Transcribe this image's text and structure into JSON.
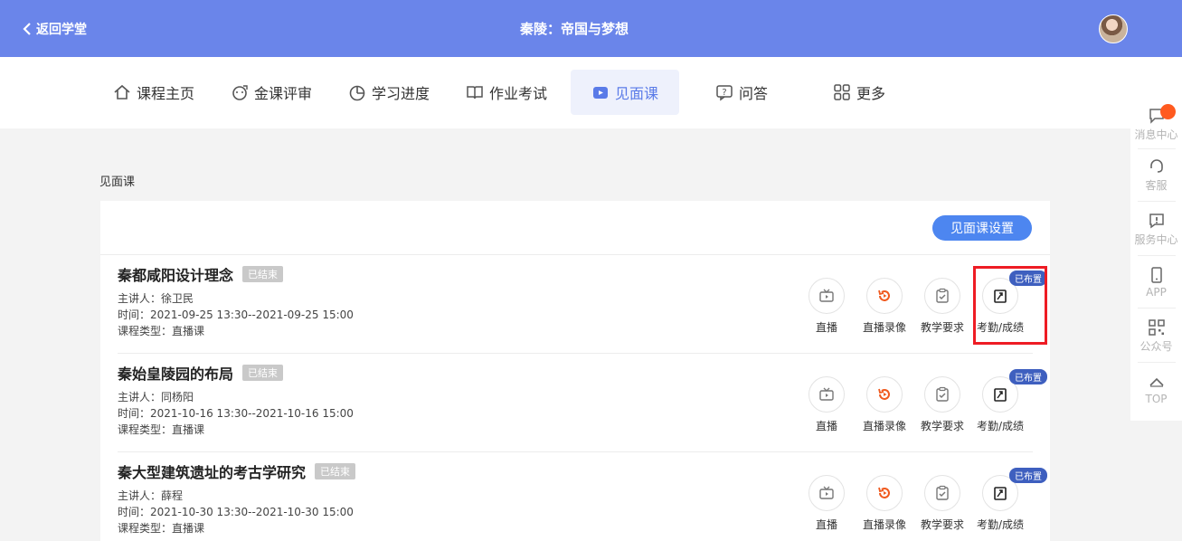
{
  "header": {
    "back_label": "返回学堂",
    "title": "秦陵：帝国与梦想"
  },
  "nav": {
    "items": [
      {
        "label": "课程主页",
        "icon": "home-icon"
      },
      {
        "label": "金课评审",
        "icon": "review-icon"
      },
      {
        "label": "学习进度",
        "icon": "pie-chart-icon"
      },
      {
        "label": "作业考试",
        "icon": "book-icon"
      },
      {
        "label": "见面课",
        "icon": "video-icon"
      },
      {
        "label": "问答",
        "icon": "question-icon"
      },
      {
        "label": "更多",
        "icon": "grid-icon"
      }
    ],
    "active": "见面课"
  },
  "section": {
    "title": "见面课",
    "settings_button": "见面课设置"
  },
  "lessons": [
    {
      "title": "秦都咸阳设计理念",
      "status": "已结束",
      "speaker": "主讲人：徐卫民",
      "time": "时间：2021-09-25 13:30--2021-09-25 15:00",
      "type": "课程类型：直播课",
      "actions": [
        "直播",
        "直播录像",
        "教学要求",
        "考勤/成绩"
      ],
      "badge": "已布置"
    },
    {
      "title": "秦始皇陵园的布局",
      "status": "已结束",
      "speaker": "主讲人：同杨阳",
      "time": "时间：2021-10-16 13:30--2021-10-16 15:00",
      "type": "课程类型：直播课",
      "actions": [
        "直播",
        "直播录像",
        "教学要求",
        "考勤/成绩"
      ],
      "badge": "已布置"
    },
    {
      "title": "秦大型建筑遗址的考古学研究",
      "status": "已结束",
      "speaker": "主讲人：薛程",
      "time": "时间：2021-10-30 13:30--2021-10-30 15:00",
      "type": "课程类型：直播课",
      "actions": [
        "直播",
        "直播录像",
        "教学要求",
        "考勤/成绩"
      ],
      "badge": "已布置"
    }
  ],
  "sidebar": {
    "items": [
      {
        "label": "消息中心",
        "icon": "message-icon"
      },
      {
        "label": "客服",
        "icon": "headset-icon"
      },
      {
        "label": "服务中心",
        "icon": "service-icon"
      },
      {
        "label": "APP",
        "icon": "phone-icon"
      },
      {
        "label": "公众号",
        "icon": "qrcode-icon"
      },
      {
        "label": "TOP",
        "icon": "arrow-up-icon"
      }
    ]
  },
  "colors": {
    "header": "#6a85ea",
    "accent": "#4d86f0",
    "record": "#f05a1f",
    "badge": "#3e5fbf",
    "highlight": "#ee1c24"
  }
}
